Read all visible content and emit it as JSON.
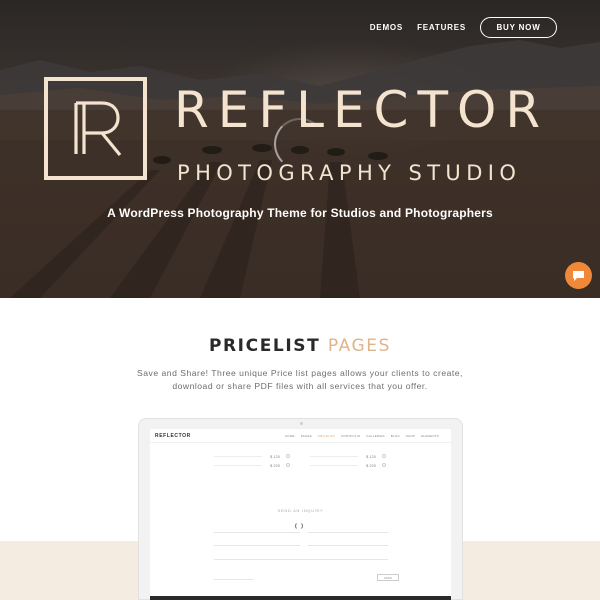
{
  "nav": {
    "links": [
      "DEMOS",
      "FEATURES"
    ],
    "buy_label": "BUY NOW"
  },
  "hero": {
    "logo_letter": "R",
    "title": "REFLECTOR",
    "subtitle": "PHOTOGRAPHY STUDIO",
    "tagline": "A WordPress Photography Theme for Studios and Photographers"
  },
  "section": {
    "title_part1": "PRICELIST",
    "title_part2": "PAGES",
    "description": "Save and Share! Three unique Price list pages allows your clients to create, download or share PDF files with all services that you offer."
  },
  "mockup": {
    "logo": "REFLECTOR",
    "menu": [
      "HOME",
      "PAGES",
      "PRICELIST",
      "PORTFOLIO",
      "GALLERIES",
      "BLOG",
      "SHOP",
      "ELEMENTS"
    ],
    "active_menu": "PRICELIST",
    "prices": [
      "$ 120",
      "$ 220",
      "$ 120",
      "$ 220"
    ],
    "inquiry_title": "SEND AN INQUIRY",
    "send_label": "SEND"
  },
  "colors": {
    "accent": "#e0b48a",
    "logo_cream": "#f3e3cf",
    "chat_orange": "#f0883a",
    "beige_band": "#f4ebe1"
  },
  "icons": {
    "chat": "chat-bubble-icon"
  }
}
